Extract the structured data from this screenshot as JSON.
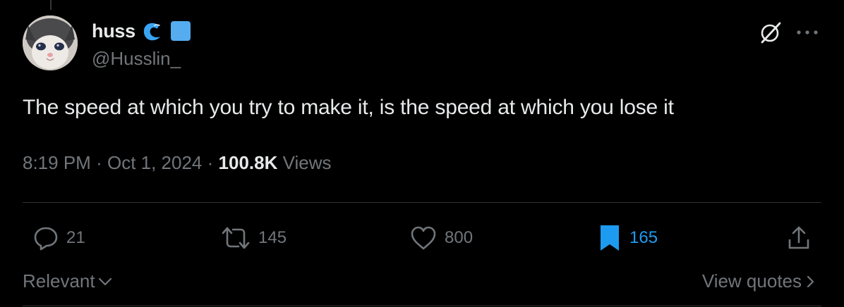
{
  "author": {
    "display_name": "huss",
    "handle": "@Husslin_",
    "badges": [
      "wave-badge-icon",
      "blue-square-badge-icon"
    ]
  },
  "top_actions": [
    "grok-icon",
    "more-options-icon"
  ],
  "tweet": {
    "text": "The speed at which you try to make it, is the speed at which you lose it",
    "time": "8:19 PM",
    "date": "Oct 1, 2024",
    "separator": "·",
    "views_count": "100.8K",
    "views_label": "Views"
  },
  "actions": {
    "replies": "21",
    "reposts": "145",
    "likes": "800",
    "bookmarks": "165"
  },
  "footer": {
    "sort_label": "Relevant",
    "view_quotes_label": "View quotes"
  },
  "colors": {
    "background": "#000000",
    "text_primary": "#e7e9ea",
    "text_secondary": "#71767b",
    "accent": "#1d9bf0",
    "divider": "#2f3336"
  }
}
